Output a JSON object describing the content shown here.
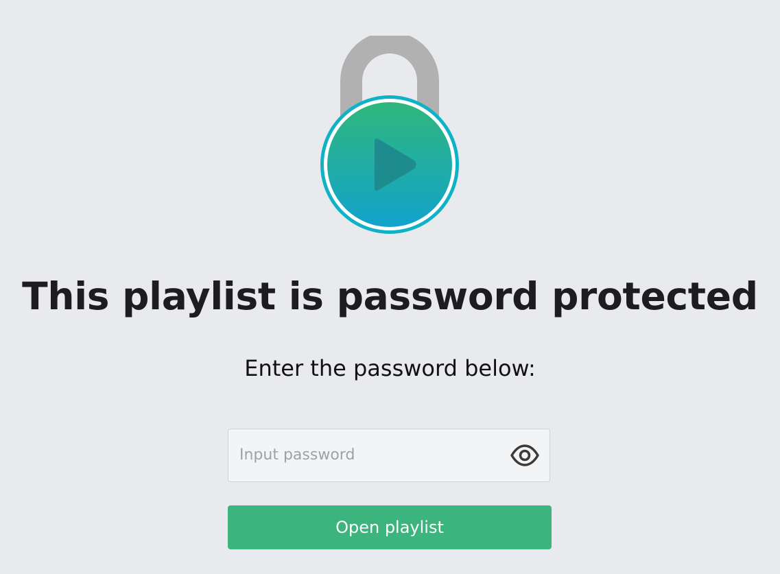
{
  "header": {
    "title": "This playlist is password protected",
    "subtitle": "Enter the password below:"
  },
  "illustration": {
    "icon": "padlock-play-icon",
    "shackle_color": "#b1b1b1",
    "ring_color": "#10b2c6",
    "gradient_top": "#30b77c",
    "gradient_bottom": "#11a3cc",
    "play_color": "#1e8b8f"
  },
  "password": {
    "placeholder": "Input password",
    "value": "",
    "toggle_icon": "eye-icon"
  },
  "button": {
    "label": "Open playlist",
    "color": "#3bb47e"
  },
  "background": "#e9eaed"
}
